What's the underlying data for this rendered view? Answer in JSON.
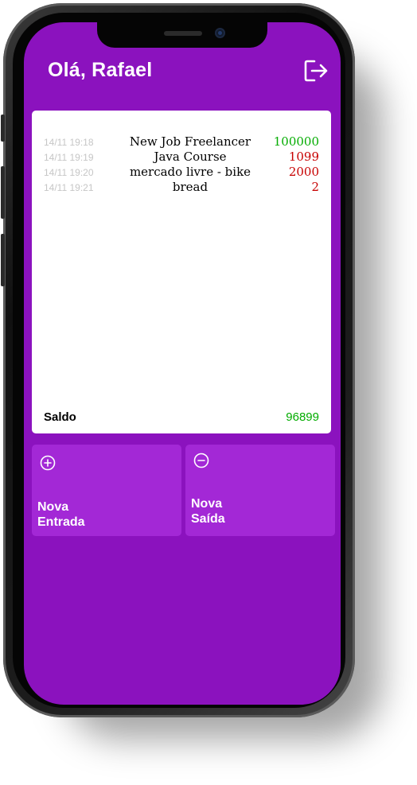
{
  "app": {
    "greeting": "Olá, Rafael"
  },
  "records": [
    {
      "date": "14/11 19:18",
      "description": "New Job Freelancer",
      "value": "100000",
      "type": "in"
    },
    {
      "date": "14/11 19:19",
      "description": "Java Course",
      "value": "1099",
      "type": "out"
    },
    {
      "date": "14/11 19:20",
      "description": "mercado livre - bike",
      "value": "2000",
      "type": "out"
    },
    {
      "date": "14/11 19:21",
      "description": "bread",
      "value": "2",
      "type": "out"
    }
  ],
  "balance": {
    "label": "Saldo",
    "value": "96899"
  },
  "actions": {
    "new_entry": {
      "line1": "Nova",
      "line2": "Entrada",
      "icon": "plus-circle-icon"
    },
    "new_exit": {
      "line1": "Nova",
      "line2": "Saída",
      "icon": "minus-circle-icon"
    }
  },
  "colors": {
    "background": "#8b12be",
    "card": "#a328d6",
    "income": "#03ac00",
    "expense": "#c70000"
  },
  "icons": {
    "logout": "logout-icon"
  }
}
